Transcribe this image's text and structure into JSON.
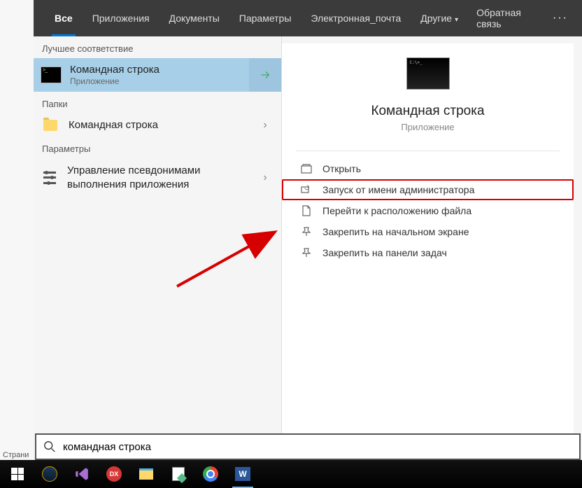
{
  "tabs": {
    "all": "Все",
    "apps": "Приложения",
    "docs": "Документы",
    "settings": "Параметры",
    "email": "Электронная_почта",
    "other": "Другие"
  },
  "feedback_label": "Обратная связь",
  "sections": {
    "best_match": "Лучшее соответствие",
    "folders": "Папки",
    "parameters": "Параметры"
  },
  "results": {
    "cmd": {
      "title": "Командная строка",
      "subtitle": "Приложение"
    },
    "folder_cmd": {
      "title": "Командная строка"
    },
    "alias": {
      "title": "Управление псевдонимами выполнения приложения"
    }
  },
  "preview": {
    "title": "Командная строка",
    "subtitle": "Приложение"
  },
  "actions": {
    "open": "Открыть",
    "run_admin": "Запуск от имени администратора",
    "open_location": "Перейти к расположению файла",
    "pin_start": "Закрепить на начальном экране",
    "pin_taskbar": "Закрепить на панели задач"
  },
  "search": {
    "value": "командная строка"
  },
  "bg_word": "Страни",
  "colors": {
    "highlight_border": "#d70000"
  }
}
